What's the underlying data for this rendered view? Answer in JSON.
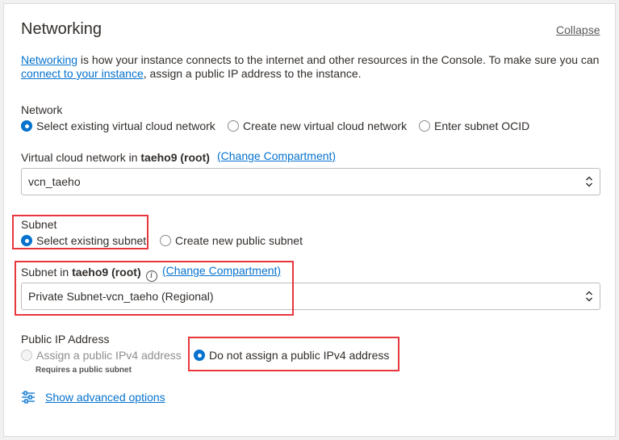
{
  "panel": {
    "title": "Networking",
    "collapse_label": "Collapse"
  },
  "description": {
    "link1": "Networking",
    "text1": " is how your instance connects to the internet and other resources in the Console. To make sure you can",
    "link2": "connect to your instance",
    "text2": ", assign a public IP address to the instance."
  },
  "network": {
    "label": "Network",
    "options": [
      {
        "label": "Select existing virtual cloud network",
        "selected": true
      },
      {
        "label": "Create new virtual cloud network",
        "selected": false
      },
      {
        "label": "Enter subnet OCID",
        "selected": false
      }
    ]
  },
  "vcn": {
    "label_prefix": "Virtual cloud network in ",
    "compartment": "taeho9 (root)",
    "change_link": "(Change Compartment)",
    "value": "vcn_taeho"
  },
  "subnet": {
    "label": "Subnet",
    "options": [
      {
        "label": "Select existing subnet",
        "selected": true
      },
      {
        "label": "Create new public subnet",
        "selected": false
      }
    ]
  },
  "subnet_in": {
    "label_prefix": "Subnet in ",
    "compartment": "taeho9 (root)",
    "info": "i",
    "change_link": "(Change Compartment)",
    "value": "Private Subnet-vcn_taeho (Regional)"
  },
  "public_ip": {
    "label": "Public IP Address",
    "assign_label": "Assign a public IPv4 address",
    "assign_hint": "Requires a public subnet",
    "no_assign_label": "Do not assign a public IPv4 address"
  },
  "advanced": {
    "label": "Show advanced options"
  },
  "colors": {
    "accent": "#0572ce",
    "highlight": "#e8363d"
  }
}
